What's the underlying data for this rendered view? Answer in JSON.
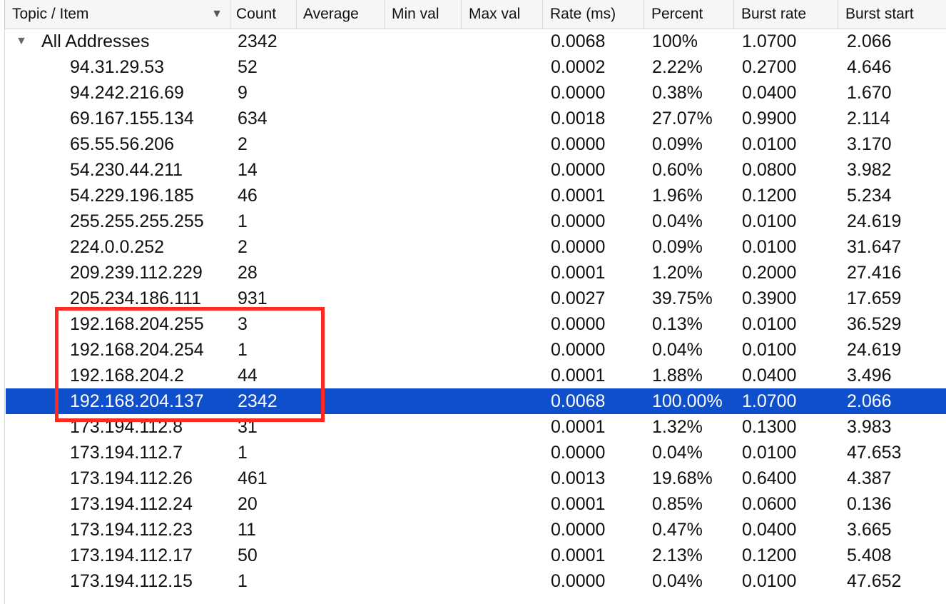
{
  "columns": [
    "Topic / Item",
    "Count",
    "Average",
    "Min val",
    "Max val",
    "Rate (ms)",
    "Percent",
    "Burst rate",
    "Burst start"
  ],
  "sort_indicator": "▼",
  "root": {
    "expander": "▼",
    "topic": "All Addresses",
    "count": "2342",
    "average": "",
    "min_val": "",
    "max_val": "",
    "rate": "0.0068",
    "percent": "100%",
    "burst_rate": "1.0700",
    "burst_start": "2.066"
  },
  "rows": [
    {
      "topic": "94.31.29.53",
      "count": "52",
      "rate": "0.0002",
      "percent": "2.22%",
      "burst_rate": "0.2700",
      "burst_start": "4.646"
    },
    {
      "topic": "94.242.216.69",
      "count": "9",
      "rate": "0.0000",
      "percent": "0.38%",
      "burst_rate": "0.0400",
      "burst_start": "1.670"
    },
    {
      "topic": "69.167.155.134",
      "count": "634",
      "rate": "0.0018",
      "percent": "27.07%",
      "burst_rate": "0.9900",
      "burst_start": "2.114"
    },
    {
      "topic": "65.55.56.206",
      "count": "2",
      "rate": "0.0000",
      "percent": "0.09%",
      "burst_rate": "0.0100",
      "burst_start": "3.170"
    },
    {
      "topic": "54.230.44.211",
      "count": "14",
      "rate": "0.0000",
      "percent": "0.60%",
      "burst_rate": "0.0800",
      "burst_start": "3.982"
    },
    {
      "topic": "54.229.196.185",
      "count": "46",
      "rate": "0.0001",
      "percent": "1.96%",
      "burst_rate": "0.1200",
      "burst_start": "5.234"
    },
    {
      "topic": "255.255.255.255",
      "count": "1",
      "rate": "0.0000",
      "percent": "0.04%",
      "burst_rate": "0.0100",
      "burst_start": "24.619"
    },
    {
      "topic": "224.0.0.252",
      "count": "2",
      "rate": "0.0000",
      "percent": "0.09%",
      "burst_rate": "0.0100",
      "burst_start": "31.647"
    },
    {
      "topic": "209.239.112.229",
      "count": "28",
      "rate": "0.0001",
      "percent": "1.20%",
      "burst_rate": "0.2000",
      "burst_start": "27.416"
    },
    {
      "topic": "205.234.186.111",
      "count": "931",
      "rate": "0.0027",
      "percent": "39.75%",
      "burst_rate": "0.3900",
      "burst_start": "17.659"
    },
    {
      "topic": "192.168.204.255",
      "count": "3",
      "rate": "0.0000",
      "percent": "0.13%",
      "burst_rate": "0.0100",
      "burst_start": "36.529"
    },
    {
      "topic": "192.168.204.254",
      "count": "1",
      "rate": "0.0000",
      "percent": "0.04%",
      "burst_rate": "0.0100",
      "burst_start": "24.619"
    },
    {
      "topic": "192.168.204.2",
      "count": "44",
      "rate": "0.0001",
      "percent": "1.88%",
      "burst_rate": "0.0400",
      "burst_start": "3.496"
    },
    {
      "topic": "192.168.204.137",
      "count": "2342",
      "rate": "0.0068",
      "percent": "100.00%",
      "burst_rate": "1.0700",
      "burst_start": "2.066",
      "selected": true
    },
    {
      "topic": "173.194.112.8",
      "count": "31",
      "rate": "0.0001",
      "percent": "1.32%",
      "burst_rate": "0.1300",
      "burst_start": "3.983"
    },
    {
      "topic": "173.194.112.7",
      "count": "1",
      "rate": "0.0000",
      "percent": "0.04%",
      "burst_rate": "0.0100",
      "burst_start": "47.653"
    },
    {
      "topic": "173.194.112.26",
      "count": "461",
      "rate": "0.0013",
      "percent": "19.68%",
      "burst_rate": "0.6400",
      "burst_start": "4.387"
    },
    {
      "topic": "173.194.112.24",
      "count": "20",
      "rate": "0.0001",
      "percent": "0.85%",
      "burst_rate": "0.0600",
      "burst_start": "0.136"
    },
    {
      "topic": "173.194.112.23",
      "count": "11",
      "rate": "0.0000",
      "percent": "0.47%",
      "burst_rate": "0.0400",
      "burst_start": "3.665"
    },
    {
      "topic": "173.194.112.17",
      "count": "50",
      "rate": "0.0001",
      "percent": "2.13%",
      "burst_rate": "0.1200",
      "burst_start": "5.408"
    },
    {
      "topic": "173.194.112.15",
      "count": "1",
      "rate": "0.0000",
      "percent": "0.04%",
      "burst_rate": "0.0100",
      "burst_start": "47.652"
    }
  ],
  "colors": {
    "selection": "#0f4fcc",
    "highlight_box": "#ff2a1f",
    "header_bg": "#f6f6f6"
  }
}
